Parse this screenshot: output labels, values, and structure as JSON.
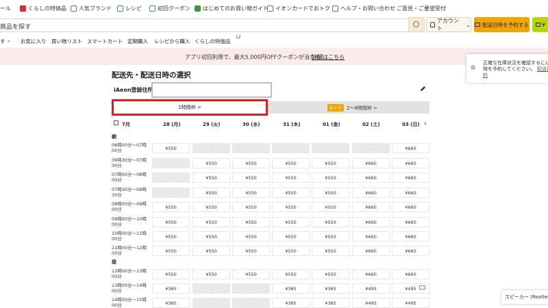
{
  "topnav": [
    {
      "label": "ール",
      "icon": "none"
    },
    {
      "label": "くらしの特価品",
      "icon": "megaphone-icon"
    },
    {
      "label": "人気ブランド",
      "icon": "brand-icon"
    },
    {
      "label": "レシピ",
      "icon": "recipe-icon"
    },
    {
      "label": "初回クーポン",
      "icon": "coupon-icon"
    },
    {
      "label": "はじめてのお買い物ガイド",
      "icon": "guide-icon"
    },
    {
      "label": "イオンカードでおトク",
      "icon": "card-icon"
    },
    {
      "label": "ヘルプ・お問い合わせ",
      "icon": "help-icon"
    },
    {
      "label": "ご意見・ご要望受付",
      "icon": "none"
    }
  ],
  "search": {
    "placeholder": "商品を探す"
  },
  "header": {
    "account_label": "アカウント",
    "delivery_button": "配送日時を予約する",
    "cart_label": "¥"
  },
  "menu": [
    "す",
    "お気に入り",
    "買い物リスト",
    "スマートカート",
    "定期購入",
    "レシピから購入",
    "くらしの特価品"
  ],
  "menu_badge": "12",
  "promo": {
    "text": "アプリ初回利用で、最大5,000円OFFクーポンが当たる！",
    "link": "詳細はこちら"
  },
  "tooltip": {
    "line1": "正確な在庫状況を確認するには",
    "line2a": "時を予約してください。",
    "line2b": "配送日",
    "line3": "約"
  },
  "page_title": "配送先・配送日時の選択",
  "address_label": "iAeon登録住所",
  "tabs": {
    "tab1": "1時間枠 >",
    "tab2_badge": "おトク",
    "tab2": "2〜8時間枠 >"
  },
  "month": "7月",
  "days": [
    "28 (月)",
    "29 (火)",
    "30 (水)",
    "31 (木)",
    "01 (金)",
    "02 (土)",
    "03 (日)"
  ],
  "sections": {
    "morning": "朝",
    "noon": "昼"
  },
  "rows": [
    {
      "time": [
        "06時00分〜07時",
        "00分"
      ],
      "cells": [
        "¥550",
        "-",
        "-",
        "-",
        "-",
        "-",
        "¥660"
      ]
    },
    {
      "time": [
        "06時30分〜07時",
        "30分"
      ],
      "cells": [
        "-",
        "¥550",
        "¥550",
        "¥550",
        "¥550",
        "¥660",
        "¥660"
      ]
    },
    {
      "time": [
        "07時00分〜08時",
        "00分"
      ],
      "cells": [
        "-",
        "¥550",
        "¥550",
        "¥550",
        "¥550",
        "¥660",
        "¥660"
      ]
    },
    {
      "time": [
        "07時30分〜08時",
        "30分"
      ],
      "cells": [
        "-",
        "¥550",
        "¥550",
        "¥550",
        "¥550",
        "¥660",
        "¥660"
      ]
    },
    {
      "time": [
        "08時00分〜09時",
        "00分"
      ],
      "cells": [
        "¥550",
        "¥550",
        "¥550",
        "¥550",
        "¥550",
        "¥660",
        "¥660"
      ]
    },
    {
      "time": [
        "09時00分〜10時",
        "00分"
      ],
      "cells": [
        "¥550",
        "¥550",
        "¥550",
        "¥550",
        "¥550",
        "¥660",
        "¥660"
      ]
    },
    {
      "time": [
        "10時00分〜11時",
        "00分"
      ],
      "cells": [
        "¥550",
        "¥550",
        "¥550",
        "¥550",
        "¥550",
        "¥660",
        "¥660"
      ]
    },
    {
      "time": [
        "11時00分〜12時",
        "00分"
      ],
      "cells": [
        "¥550",
        "¥550",
        "¥550",
        "¥550",
        "¥550",
        "¥660",
        "¥660"
      ]
    },
    {
      "time": [
        "12時00分〜13時",
        "00分"
      ],
      "cells": [
        "¥550",
        "¥550",
        "¥550",
        "¥550",
        "¥550",
        "¥660",
        "¥660"
      ]
    },
    {
      "time": [
        "13時00分〜14時",
        "00分"
      ],
      "cells": [
        "¥385",
        "-",
        "-",
        "¥385",
        "¥385",
        "¥495",
        "¥495"
      ]
    },
    {
      "time": [
        "14時00分〜15時",
        "00分"
      ],
      "cells": [
        "¥385",
        "-",
        "-",
        "¥385",
        "¥385",
        "¥495",
        "¥495"
      ]
    }
  ],
  "taskbar_tooltip": "スピーカー (Realtek(R)"
}
